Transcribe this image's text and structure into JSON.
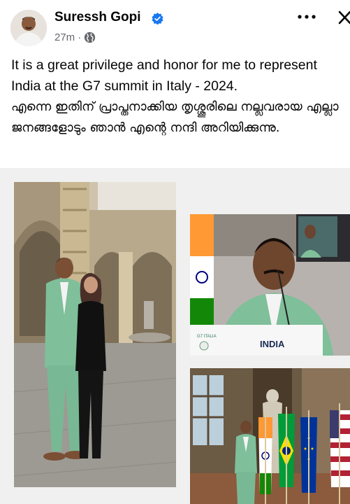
{
  "post": {
    "author": "Suressh Gopi",
    "time": "27m",
    "dot": "·",
    "text_en": "It is a great privilege and honor for me to represent India at the G7 summit in Italy - 2024.",
    "text_ml": "എന്നെ ഇതിന് പ്രാപ്തനാക്കിയ തൃശ്ശൂരിലെ നല്ലവരായ എല്ലാ ജനങ്ങളോടും ഞാൻ എന്റെ നന്ദി അറിയിക്കുന്നു."
  },
  "icons": {
    "verified": "verified-badge-icon",
    "privacy": "globe-icon",
    "more": "more-options-icon",
    "close": "close-icon"
  },
  "photos": {
    "summit_sign": "INDIA",
    "summit_logo": "G7 ITALIA"
  },
  "colors": {
    "verified_blue": "#1877f2",
    "meta_gray": "#65676b",
    "suit_green": "#7fbf9a"
  }
}
